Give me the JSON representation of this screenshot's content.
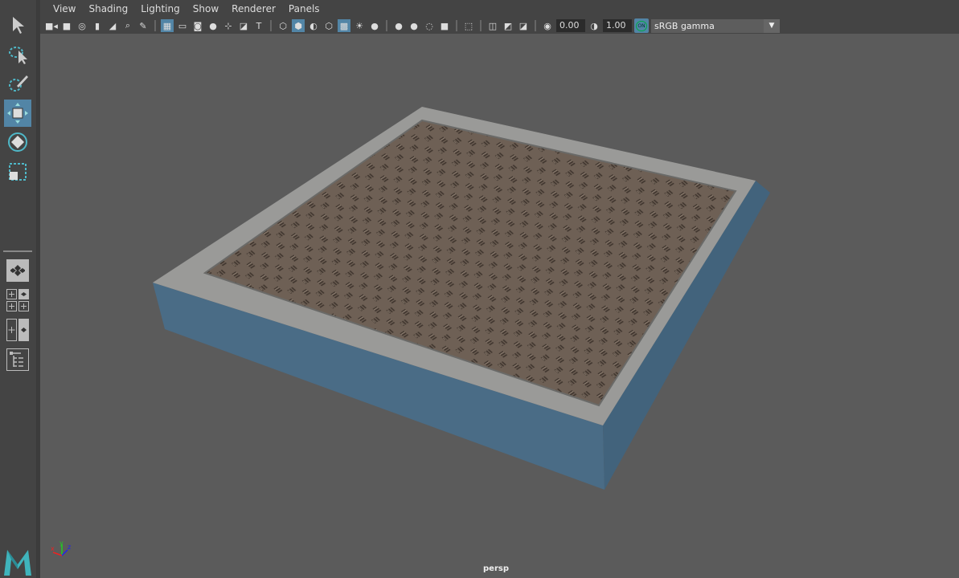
{
  "menu": [
    "View",
    "Shading",
    "Lighting",
    "Show",
    "Renderer",
    "Panels"
  ],
  "toolbar": {
    "icons": [
      "camera-icon",
      "lock-camera-icon",
      "camera-attributes-icon",
      "bookmark-icon",
      "image-plane-icon",
      "2d-pan-zoom-icon",
      "grease-pencil-icon",
      "|",
      "grid-icon",
      "film-gate-icon",
      "resolution-gate-icon",
      "gate-mask-icon",
      "field-chart-icon",
      "safe-action-icon",
      "safe-title-icon",
      "|",
      "wireframe-icon",
      "smooth-shade-icon",
      "default-material-icon",
      "wireframe-on-shaded-icon",
      "textured-icon",
      "lights-icon",
      "shadows-icon",
      "|",
      "ambient-occlusion-icon",
      "motion-blur-icon",
      "anti-aliasing-icon",
      "depth-of-field-icon",
      "|",
      "isolate-select-icon",
      "|",
      "xray-icon",
      "xray-active-components-icon",
      "xray-joints-icon",
      "|",
      "exposure-icon"
    ],
    "active": [
      "grid-icon",
      "smooth-shade-icon",
      "textured-icon"
    ],
    "exposure": "0.00",
    "gamma": "1.00",
    "color_mgmt_badge": "ON",
    "color_space": "sRGB gamma"
  },
  "left_tools": [
    "select-tool-icon",
    "lasso-tool-icon",
    "paint-select-tool-icon",
    "move-tool-icon",
    "rotate-tool-icon",
    "scale-tool-icon"
  ],
  "active_tool": "move-tool-icon",
  "layout_tools": [
    "single-pane-layout-icon",
    "four-pane-layout-icon",
    "two-pane-layout-icon",
    "outliner-layout-icon"
  ],
  "viewport": {
    "camera": "persp",
    "axis": {
      "x": "x",
      "y": "y",
      "z": "z"
    }
  },
  "colors": {
    "accent": "#5285a6",
    "viewport_bg": "#5b5b5b",
    "side": "#4a6c86",
    "rim": "#9a9a98",
    "floor": "#6e6055"
  }
}
